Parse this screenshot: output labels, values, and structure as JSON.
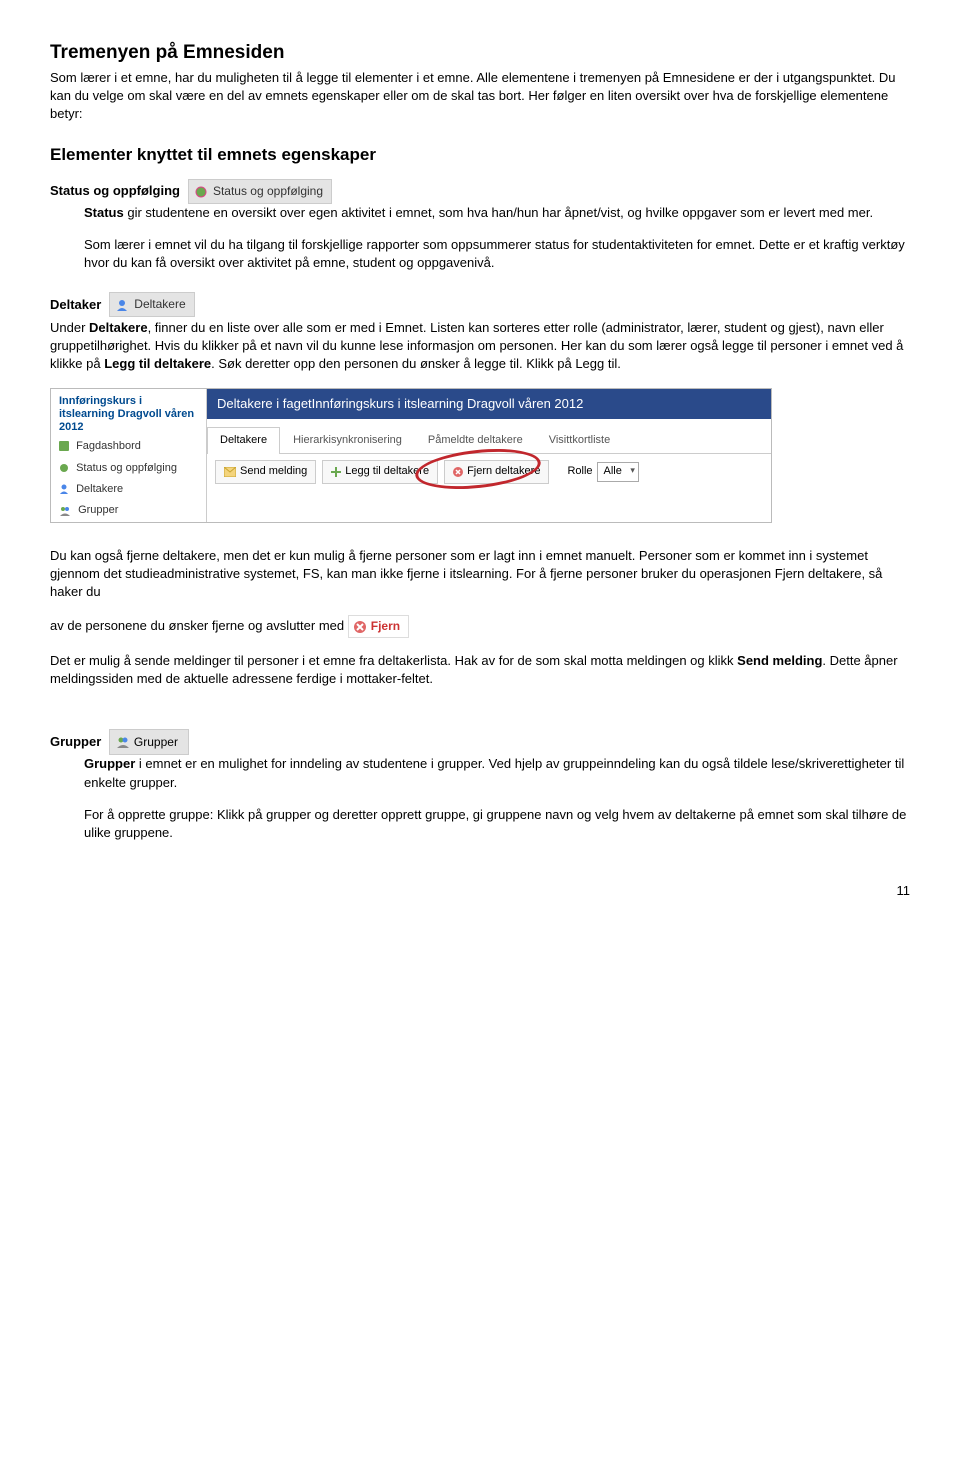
{
  "h1": "Tremenyen på Emnesiden",
  "intro": "Som lærer i et emne, har du muligheten til å legge til elementer i et emne. Alle elementene i tremenyen på Emnesidene er der i utgangspunktet. Du kan du velge om skal være en del av emnets egenskaper eller om de skal tas bort. Her følger en liten oversikt over hva de forskjellige elementene betyr:",
  "h2": "Elementer knyttet til emnets egenskaper",
  "status": {
    "heading": "Status og oppfølging",
    "chip": "Status og oppfølging",
    "p1a": "Status",
    "p1b": " gir studentene en oversikt over egen aktivitet i emnet, som hva han/hun har åpnet/vist, og hvilke oppgaver som er levert med mer.",
    "p2": "Som lærer i emnet vil du ha tilgang til forskjellige rapporter som oppsummerer status for studentaktiviteten for emnet. Dette er et kraftig verktøy hvor du kan få oversikt over aktivitet på emne, student og oppgavenivå."
  },
  "deltaker": {
    "heading": "Deltaker",
    "chip": "Deltakere",
    "p1a": "Under ",
    "p1b": "Deltakere",
    "p1c": ", finner du en liste over alle som er med i Emnet. Listen kan sorteres etter rolle (administrator, lærer, student og gjest), navn eller gruppetilhørighet. Hvis du klikker på et navn vil du kunne lese informasjon om personen. Her kan du som lærer også legge til personer i emnet ved å klikke på ",
    "p1d": "Legg til deltakere",
    "p1e": ". Søk deretter opp den personen du ønsker å legge til. Klikk på Legg til."
  },
  "screenshot": {
    "sidebar": {
      "courseTitle": "Innføringskurs i itslearning Dragvoll våren 2012",
      "items": [
        "Fagdashbord",
        "Status og oppfølging",
        "Deltakere",
        "Grupper"
      ]
    },
    "bluebar": "Deltakere i fagetInnføringskurs i itslearning Dragvoll våren 2012",
    "tabs": [
      "Deltakere",
      "Hierarkisynkronisering",
      "Påmeldte deltakere",
      "Visittkortliste"
    ],
    "toolbar": {
      "send": "Send melding",
      "add": "Legg til deltakere",
      "remove": "Fjern deltakere",
      "rolleLabel": "Rolle",
      "rolleValue": "Alle"
    }
  },
  "fjern": {
    "p1": "Du kan også fjerne deltakere, men det er kun mulig å fjerne personer som er lagt inn i emnet manuelt. Personer som er kommet inn i systemet gjennom det studieadministrative systemet, FS, kan man ikke fjerne i itslearning. For å fjerne personer bruker du operasjonen Fjern deltakere, så haker du",
    "p2": "av de personene du ønsker fjerne og avslutter med",
    "chip": "Fjern",
    "p3a": "Det er mulig å sende meldinger til personer i et emne fra deltakerlista. Hak av for de som skal motta meldingen og klikk ",
    "p3b": "Send melding",
    "p3c": ". Dette åpner meldingssiden med de aktuelle adressene ferdige i mottaker-feltet."
  },
  "grupper": {
    "heading": "Grupper",
    "chip": "Grupper",
    "p1a": "Grupper",
    "p1b": " i emnet er en mulighet for inndeling av studentene i grupper. Ved hjelp av gruppeinndeling kan du også tildele lese/skriverettigheter til enkelte grupper.",
    "p2": "For å opprette gruppe: Klikk på grupper og deretter opprett gruppe, gi gruppene navn og velg hvem av deltakerne på emnet som skal tilhøre de ulike gruppene."
  },
  "pageNumber": "11"
}
